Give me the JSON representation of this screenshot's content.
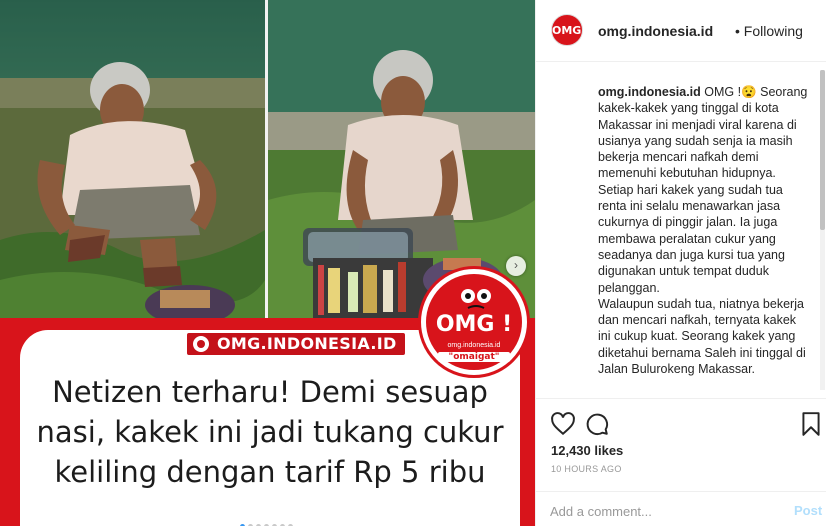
{
  "media": {
    "brand_tag": "OMG.INDONESIA.ID",
    "headline_lines": [
      "Netizen terharu! Demi sesuap",
      "nasi, kakek ini jadi tukang cukur",
      "keliling dengan tarif Rp 5 ribu"
    ],
    "badge": {
      "omg": "OMG !",
      "site": "omg.indonesia.id",
      "tagline": "\"omaigat\""
    },
    "carousel_dot_count": 7,
    "carousel_active_index": 0
  },
  "post": {
    "header": {
      "avatar_text": "OMG!",
      "username": "omg.indonesia.id",
      "follow_state": "• Following"
    },
    "caption": {
      "user": "omg.indonesia.id",
      "paragraphs": [
        "OMG !😧 Seorang kakek-kakek yang tinggal di kota Makassar ini menjadi viral karena di usianya yang sudah senja ia masih bekerja mencari nafkah demi memenuhi kebutuhan hidupnya.",
        "Setiap hari kakek yang sudah tua renta ini selalu menawarkan jasa cukurnya di pinggir jalan. Ia juga membawa peralatan cukur yang seadanya dan juga kursi tua yang digunakan untuk tempat duduk pelanggan.",
        "Walaupun sudah tua, niatnya bekerja dan mencari nafkah, ternyata kakek ini cukup kuat. Seorang kakek yang diketahui bernama Saleh ini tinggal di Jalan Bulurokeng Makassar."
      ]
    },
    "actions": {
      "like_icon": "heart-icon",
      "comment_icon": "comment-icon",
      "save_icon": "bookmark-icon"
    },
    "likes": "12,430 likes",
    "timestamp": "10 HOURS AGO",
    "comment": {
      "placeholder": "Add a comment...",
      "post_label": "Post"
    }
  },
  "colors": {
    "brand_red": "#d8141b",
    "link_blue": "#3897f0",
    "post_disabled": "#b2dffc"
  }
}
